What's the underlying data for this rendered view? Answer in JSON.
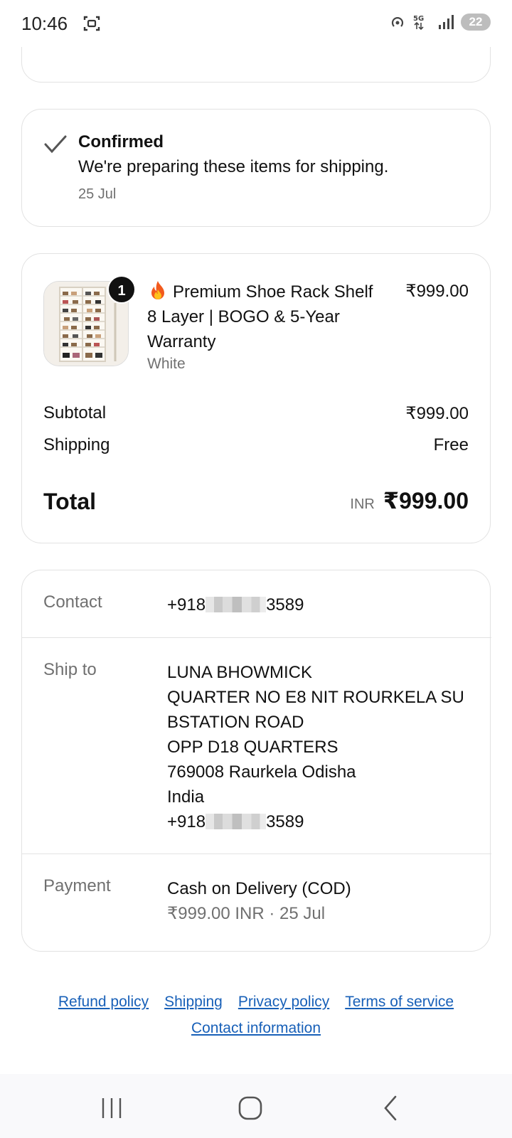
{
  "status_bar": {
    "time": "10:46",
    "battery": "22",
    "network": "5G"
  },
  "confirmation": {
    "title": "Confirmed",
    "description": "We're preparing these items for shipping.",
    "date": "25 Jul"
  },
  "order": {
    "item": {
      "quantity": "1",
      "title": "Premium Shoe Rack Shelf 8 Layer | BOGO & 5-Year Warranty",
      "variant": "White",
      "price": "₹999.00"
    },
    "subtotal_label": "Subtotal",
    "subtotal_value": "₹999.00",
    "shipping_label": "Shipping",
    "shipping_value": "Free",
    "total_label": "Total",
    "total_currency": "INR",
    "total_value": "₹999.00"
  },
  "info": {
    "contact_label": "Contact",
    "contact_prefix": "+918",
    "contact_suffix": "3589",
    "ship_label": "Ship to",
    "ship_name": "LUNA BHOWMICK",
    "ship_line1": "QUARTER NO E8 NIT ROURKELA SU",
    "ship_line2": "BSTATION ROAD",
    "ship_line3": "OPP D18 QUARTERS",
    "ship_line4": "769008 Raurkela Odisha",
    "ship_country": "India",
    "ship_phone_prefix": "+918",
    "ship_phone_suffix": "3589",
    "payment_label": "Payment",
    "payment_method": "Cash on Delivery (COD)",
    "payment_detail": "₹999.00 INR · 25 Jul"
  },
  "footer_links": {
    "refund": "Refund policy",
    "shipping": "Shipping",
    "privacy": "Privacy policy",
    "terms": "Terms of service",
    "contact": "Contact information"
  },
  "colors": {
    "link": "#1860b8",
    "muted": "#707070",
    "border": "#e2e2e2"
  }
}
